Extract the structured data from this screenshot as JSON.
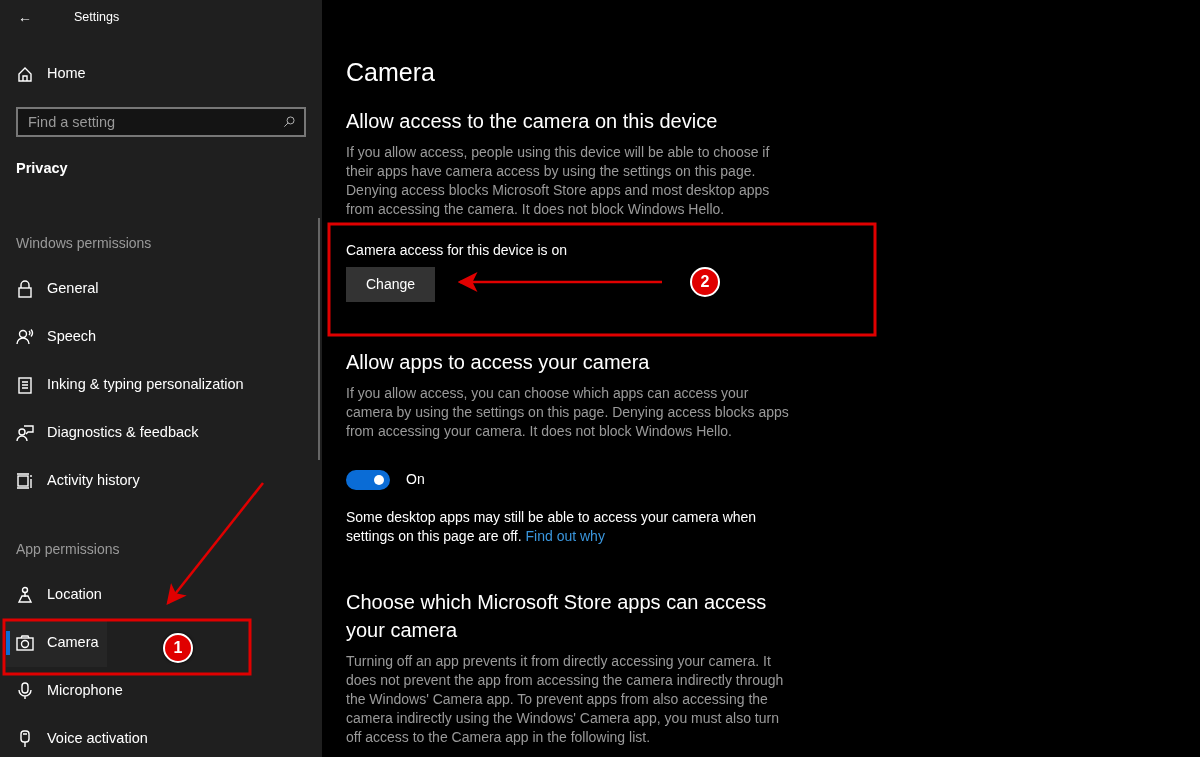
{
  "window": {
    "title": "Settings",
    "back": "←"
  },
  "sidebar": {
    "home": {
      "label": "Home",
      "kind": "home"
    },
    "search": {
      "placeholder": "Find a setting"
    },
    "category": "Privacy",
    "groups": [
      {
        "title": "Windows permissions",
        "items": [
          {
            "label": "General",
            "kind": "lock",
            "selected": false
          },
          {
            "label": "Speech",
            "kind": "speech",
            "selected": false
          },
          {
            "label": "Inking & typing personalization",
            "kind": "inking",
            "selected": false
          },
          {
            "label": "Diagnostics & feedback",
            "kind": "diagnostics",
            "selected": false
          },
          {
            "label": "Activity history",
            "kind": "activity",
            "selected": false
          }
        ]
      },
      {
        "title": "App permissions",
        "items": [
          {
            "label": "Location",
            "kind": "location",
            "selected": false
          },
          {
            "label": "Camera",
            "kind": "camera",
            "selected": true
          },
          {
            "label": "Microphone",
            "kind": "microphone",
            "selected": false
          },
          {
            "label": "Voice activation",
            "kind": "voice",
            "selected": false
          }
        ]
      }
    ]
  },
  "main": {
    "title": "Camera",
    "sections": [
      {
        "kind": "device",
        "heading": "Allow access to the camera on this device",
        "description": "If you allow access, people using this device will be able to choose if their apps have camera access by using the settings on this page. Denying access blocks Microsoft Store apps and most desktop apps from accessing the camera. It does not block Windows Hello.",
        "status": "Camera access for this device is on",
        "button": "Change"
      },
      {
        "kind": "toggle",
        "heading": "Allow apps to access your camera",
        "description": "If you allow access, you can choose which apps can access your camera by using the settings on this page. Denying access blocks apps from accessing your camera. It does not block Windows Hello.",
        "toggle": {
          "on": true,
          "label": "On"
        },
        "note": "Some desktop apps may still be able to access your camera when settings on this page are off.",
        "link": "Find out why"
      },
      {
        "kind": "text",
        "heading": "Choose which Microsoft Store apps can access your camera",
        "description": "Turning off an app prevents it from directly accessing your camera. It does not prevent the app from accessing the camera indirectly through the Windows' Camera app. To prevent apps from also accessing the camera indirectly using the Windows' Camera app, you must also turn off access to the Camera app in the following list."
      }
    ]
  },
  "annotations": [
    {
      "number": "1"
    },
    {
      "number": "2"
    }
  ]
}
